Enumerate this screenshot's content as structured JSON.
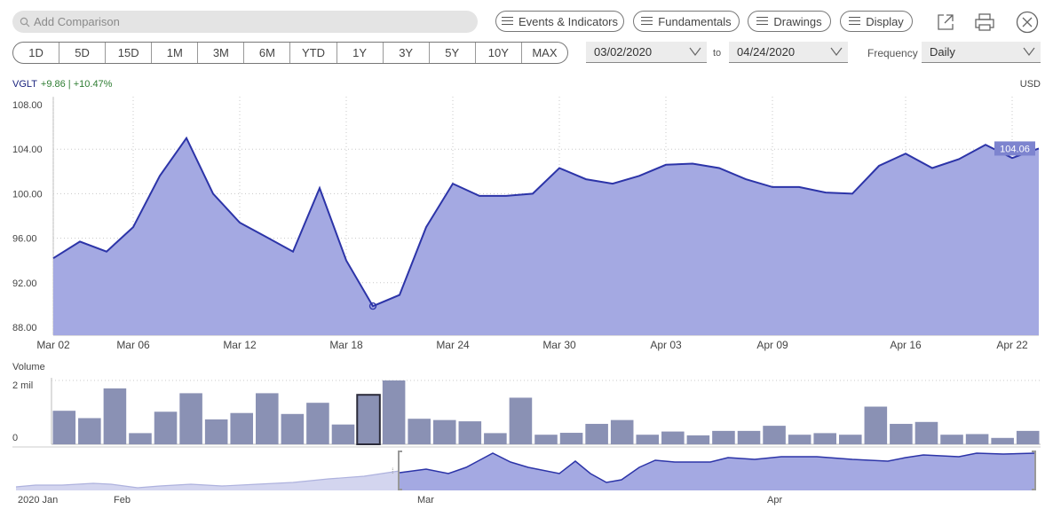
{
  "toolbar": {
    "search_placeholder": "Add Comparison",
    "events_label": "Events & Indicators",
    "fundamentals_label": "Fundamentals",
    "drawings_label": "Drawings",
    "display_label": "Display",
    "icons": [
      "popout-icon",
      "print-icon",
      "close-icon"
    ]
  },
  "ranges": [
    "1D",
    "5D",
    "15D",
    "1M",
    "3M",
    "6M",
    "YTD",
    "1Y",
    "3Y",
    "5Y",
    "10Y",
    "MAX"
  ],
  "date_range": {
    "from": "03/02/2020",
    "to_label": "to",
    "to": "04/24/2020"
  },
  "frequency": {
    "label": "Frequency",
    "value": "Daily"
  },
  "header": {
    "ticker": "VGLT",
    "change": "+9.86 | +10.47%",
    "currency": "USD"
  },
  "colors": {
    "line": "#2c34a8",
    "fill": "#a4a9e2",
    "volume_bar": "#8a91b4",
    "volume_highlight": "#2b2b3a",
    "navigator_fill": "#a4a9e2",
    "navigator_pre": "#d3d5ef"
  },
  "chart_data": [
    {
      "type": "area",
      "series": [
        {
          "name": "VGLT",
          "values": [
            94.2,
            95.7,
            94.8,
            97.0,
            101.6,
            105.0,
            100.0,
            97.4,
            96.1,
            94.8,
            100.5,
            94.0,
            89.9,
            90.9,
            97.0,
            100.9,
            99.8,
            99.8,
            100.0,
            102.3,
            101.3,
            100.9,
            101.6,
            102.6,
            102.7,
            102.3,
            101.3,
            100.6,
            100.6,
            100.1,
            100.0,
            102.5,
            103.6,
            102.3,
            103.1,
            104.4,
            103.2,
            104.06
          ]
        }
      ],
      "ylim": [
        88,
        108
      ],
      "yticks": [
        "108.00",
        "104.00",
        "100.00",
        "96.00",
        "92.00",
        "88.00"
      ],
      "xticks": [
        "Mar 02",
        "Mar 06",
        "Mar 12",
        "Mar 18",
        "Mar 24",
        "Mar 30",
        "Apr 03",
        "Apr 09",
        "Apr 16",
        "Apr 22"
      ],
      "xtick_index": [
        0,
        3,
        7,
        11,
        15,
        19,
        23,
        27,
        32,
        36
      ],
      "last_value_label": "104.06",
      "low_marker_index": 12
    },
    {
      "type": "bar",
      "label": "Volume",
      "yticks": [
        "2 mil",
        "0"
      ],
      "values": [
        1.05,
        0.82,
        1.75,
        0.35,
        1.02,
        1.6,
        0.78,
        0.98,
        1.6,
        0.95,
        1.3,
        0.62,
        1.55,
        2.0,
        0.8,
        0.76,
        0.72,
        0.35,
        1.46,
        0.3,
        0.36,
        0.64,
        0.76,
        0.3,
        0.4,
        0.28,
        0.42,
        0.42,
        0.58,
        0.3,
        0.35,
        0.3,
        1.18,
        0.64,
        0.7,
        0.3,
        0.32,
        0.2,
        0.42
      ],
      "highlight_index": 12
    },
    {
      "type": "area",
      "label": "navigator",
      "xticks": [
        "2020 Jan",
        "Feb",
        "Mar",
        "Apr"
      ]
    }
  ]
}
